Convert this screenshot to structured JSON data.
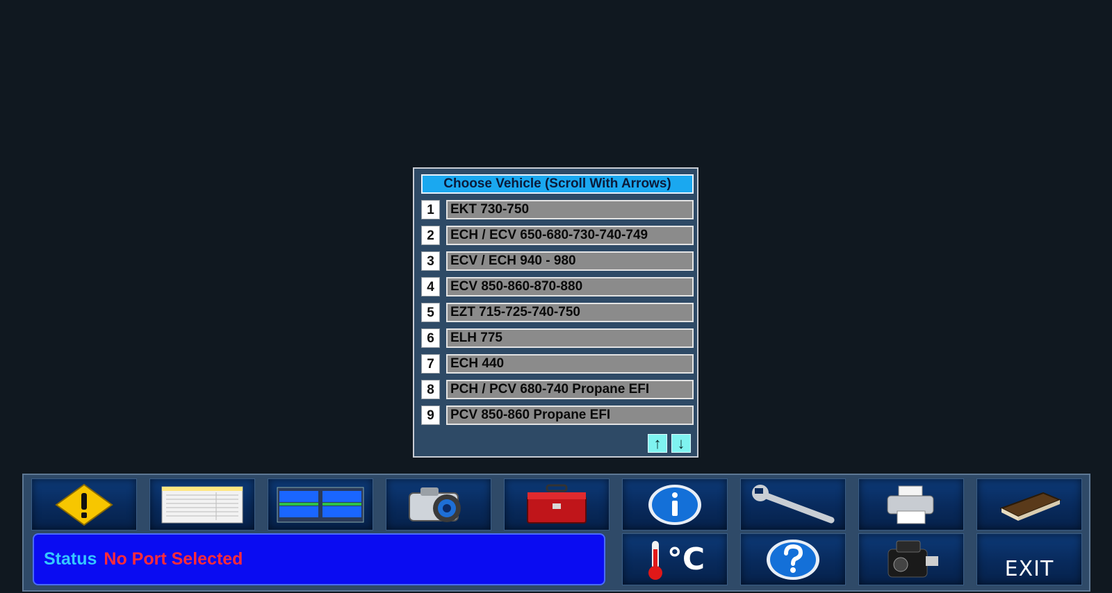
{
  "chooser": {
    "title": "Choose Vehicle (Scroll With Arrows)",
    "items": [
      {
        "num": "1",
        "label": "EKT 730-750"
      },
      {
        "num": "2",
        "label": "ECH / ECV 650-680-730-740-749"
      },
      {
        "num": "3",
        "label": "ECV / ECH 940 - 980"
      },
      {
        "num": "4",
        "label": "ECV 850-860-870-880"
      },
      {
        "num": "5",
        "label": "EZT 715-725-740-750"
      },
      {
        "num": "6",
        "label": "ELH 775"
      },
      {
        "num": "7",
        "label": "ECH 440"
      },
      {
        "num": "8",
        "label": "PCH / PCV 680-740 Propane EFI"
      },
      {
        "num": "9",
        "label": "PCV 850-860 Propane EFI"
      }
    ],
    "scroll_up": "↑",
    "scroll_down": "↓"
  },
  "toolbar": {
    "icons": [
      "warning-icon",
      "data-list-icon",
      "gauges-icon",
      "camera-icon",
      "toolbox-icon",
      "info-icon",
      "wrench-icon",
      "printer-icon",
      "manual-book-icon",
      "temperature-icon",
      "help-icon",
      "engine-icon"
    ],
    "celsius": "°C",
    "exit_label": "EXIT"
  },
  "status": {
    "label": "Status",
    "value": "No Port Selected"
  },
  "colors": {
    "background": "#101820",
    "status_label": "#34c8ff",
    "status_value": "#ff2b3a",
    "status_bg": "#0a0cf2"
  }
}
